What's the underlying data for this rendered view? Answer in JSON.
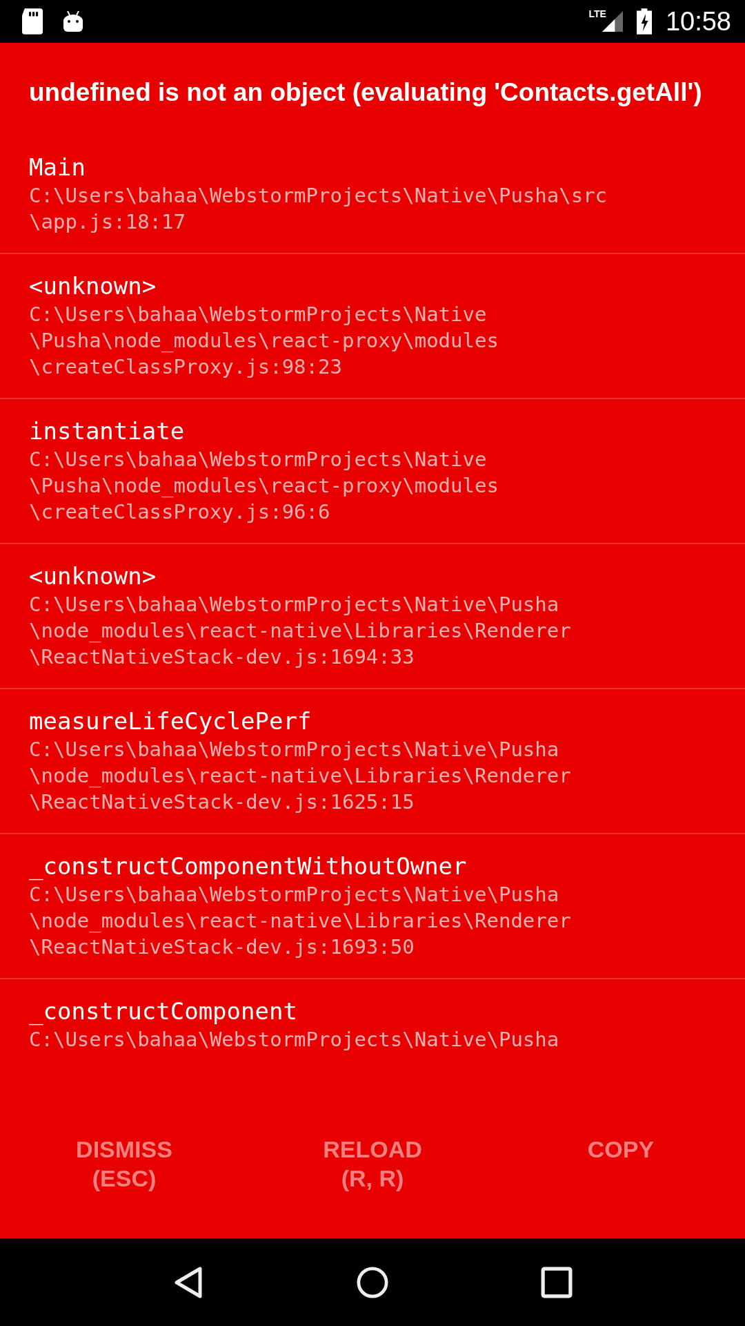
{
  "status_bar": {
    "network": "LTE",
    "time": "10:58"
  },
  "error": {
    "message": "undefined is not an object (evaluating 'Contacts.getAll')"
  },
  "stack": [
    {
      "method": "Main",
      "file": [
        "C:\\Users\\bahaa\\WebstormProjects\\Native\\Pusha\\src",
        "\\app.js:18:17"
      ]
    },
    {
      "method": "<unknown>",
      "file": [
        "C:\\Users\\bahaa\\WebstormProjects\\Native",
        "\\Pusha\\node_modules\\react-proxy\\modules",
        "\\createClassProxy.js:98:23"
      ]
    },
    {
      "method": "instantiate",
      "file": [
        "C:\\Users\\bahaa\\WebstormProjects\\Native",
        "\\Pusha\\node_modules\\react-proxy\\modules",
        "\\createClassProxy.js:96:6"
      ]
    },
    {
      "method": "<unknown>",
      "file": [
        "C:\\Users\\bahaa\\WebstormProjects\\Native\\Pusha",
        "\\node_modules\\react-native\\Libraries\\Renderer",
        "\\ReactNativeStack-dev.js:1694:33"
      ]
    },
    {
      "method": "measureLifeCyclePerf",
      "file": [
        "C:\\Users\\bahaa\\WebstormProjects\\Native\\Pusha",
        "\\node_modules\\react-native\\Libraries\\Renderer",
        "\\ReactNativeStack-dev.js:1625:15"
      ]
    },
    {
      "method": "_constructComponentWithoutOwner",
      "file": [
        "C:\\Users\\bahaa\\WebstormProjects\\Native\\Pusha",
        "\\node_modules\\react-native\\Libraries\\Renderer",
        "\\ReactNativeStack-dev.js:1693:50"
      ]
    },
    {
      "method": "_constructComponent",
      "file": [
        "C:\\Users\\bahaa\\WebstormProjects\\Native\\Pusha"
      ]
    }
  ],
  "buttons": [
    {
      "lines": [
        "DISMISS",
        "(ESC)"
      ]
    },
    {
      "lines": [
        "RELOAD",
        "(R, R)"
      ]
    },
    {
      "lines": [
        "COPY"
      ]
    }
  ]
}
